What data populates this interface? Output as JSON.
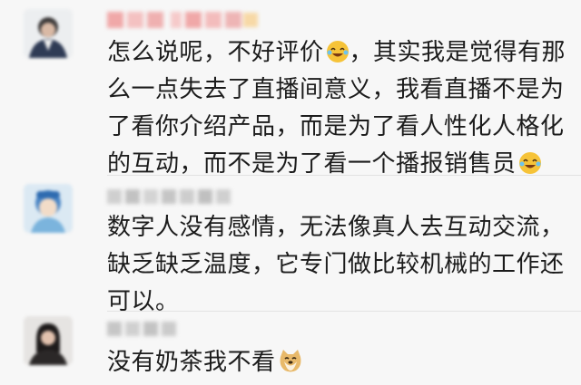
{
  "comments": [
    {
      "name": "",
      "text": "怎么说呢，不好评价",
      "text_rest": "，其实我是觉得有那么一点失去了直播间意义，我看直播不是为了看你介绍产品，而是为了看人性化人格化的互动，而不是为了看一个播报销售员",
      "emoji": "laughing-crying-emoji",
      "emoji_end": "laughing-crying-emoji"
    },
    {
      "name": "",
      "text": "数字人没有感情，无法像真人去互动交流，缺乏缺乏温度，它专门做比较机械的工作还可以。"
    },
    {
      "name": "",
      "text": "没有奶茶我不看",
      "emoji": "doge-emoji"
    }
  ],
  "colors": {
    "background": "#f7f7f7",
    "text": "#1c1c1c",
    "name_blur_pink": "#f2b6b6",
    "name_blur_gray": "#c9c9c9"
  }
}
